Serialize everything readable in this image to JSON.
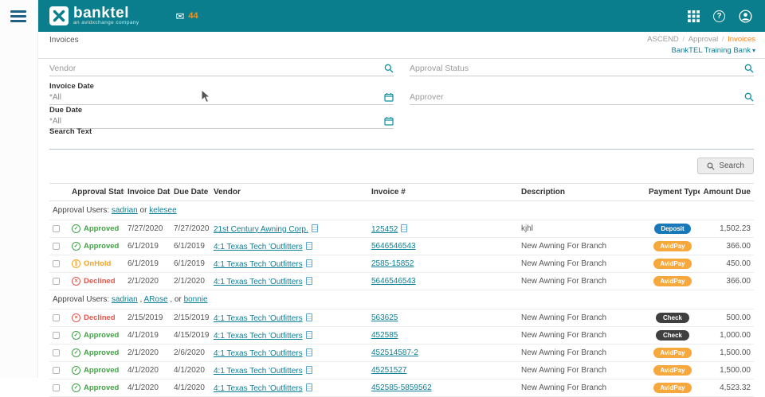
{
  "colors": {
    "header_teal": "#0a7e8c",
    "accent_orange": "#f58220",
    "link_teal": "#0e7f95",
    "status_approved": "#43a047",
    "status_onhold": "#f5a324",
    "status_declined": "#e2574c",
    "pill_deposit": "#1779ba",
    "pill_avidpay": "#f6a83c",
    "pill_check": "#3f3f3f"
  },
  "header": {
    "brand": "banktel",
    "brand_subtitle": "an avidxchange company",
    "inbox_count": "44"
  },
  "breadcrumb": {
    "page_title": "Invoices",
    "trail": [
      "ASCEND",
      "Approval",
      "Invoices"
    ],
    "separator": "/",
    "bank_name": "BankTEL Training Bank",
    "caret": "▾"
  },
  "filters": {
    "vendor": {
      "placeholder": "Vendor",
      "value": ""
    },
    "approval_status": {
      "placeholder": "Approval Status",
      "value": ""
    },
    "invoice_date": {
      "label": "Invoice Date",
      "value": "*All"
    },
    "approver": {
      "placeholder": "Approver",
      "value": ""
    },
    "due_date": {
      "label": "Due Date",
      "value": "*All"
    },
    "search_text": {
      "label": "Search Text",
      "value": ""
    },
    "search_button_label": "Search"
  },
  "status_icons": {
    "Approved": "✓",
    "OnHold": "∥",
    "Declined": "×"
  },
  "mail_glyph": "✉",
  "table": {
    "columns": [
      "",
      "Approval Status",
      "Invoice Date",
      "Due Date",
      "Vendor",
      "Invoice #",
      "Description",
      "Payment Type",
      "Amount Due"
    ],
    "groups": [
      {
        "prefix": "Approval Users: ",
        "parts": [
          {
            "text": "sadrian",
            "link": true
          },
          {
            "text": " or ",
            "link": false
          },
          {
            "text": "kelesee",
            "link": true
          }
        ],
        "rows": [
          {
            "status": "Approved",
            "invoice_date": "7/27/2020",
            "due_date": "7/27/2020",
            "vendor": "21st Century Awning Corp.",
            "invoice_no": "125452",
            "invoice_doc": true,
            "description": "kjhl",
            "payment_type": "Deposit",
            "amount_due": "1,502.23"
          },
          {
            "status": "Approved",
            "invoice_date": "6/1/2019",
            "due_date": "6/1/2019",
            "vendor": "4:1 Texas Tech 'Outfitters",
            "invoice_no": "5646546543",
            "invoice_doc": false,
            "description": "New Awning For Branch",
            "payment_type": "AvidPay",
            "amount_due": "366.00"
          },
          {
            "status": "OnHold",
            "invoice_date": "6/1/2019",
            "due_date": "6/1/2019",
            "vendor": "4:1 Texas Tech 'Outfitters",
            "invoice_no": "2585-15852",
            "invoice_doc": false,
            "description": "New Awning For Branch",
            "payment_type": "AvidPay",
            "amount_due": "450.00"
          },
          {
            "status": "Declined",
            "invoice_date": "2/1/2020",
            "due_date": "2/1/2020",
            "vendor": "4:1 Texas Tech 'Outfitters",
            "invoice_no": "5646546543",
            "invoice_doc": false,
            "description": "New Awning For Branch",
            "payment_type": "AvidPay",
            "amount_due": "366.00"
          }
        ]
      },
      {
        "prefix": "Approval Users: ",
        "parts": [
          {
            "text": "sadrian",
            "link": true
          },
          {
            "text": " , ",
            "link": false
          },
          {
            "text": "ARose",
            "link": true
          },
          {
            "text": " , or ",
            "link": false
          },
          {
            "text": "bonnie",
            "link": true
          }
        ],
        "rows": [
          {
            "status": "Declined",
            "invoice_date": "2/15/2019",
            "due_date": "2/15/2019",
            "vendor": "4:1 Texas Tech 'Outfitters",
            "invoice_no": "563625",
            "invoice_doc": false,
            "description": "New Awning For Branch",
            "payment_type": "Check",
            "amount_due": "500.00"
          },
          {
            "status": "Approved",
            "invoice_date": "4/1/2019",
            "due_date": "4/15/2019",
            "vendor": "4:1 Texas Tech 'Outfitters",
            "invoice_no": "452585",
            "invoice_doc": false,
            "description": "New Awning For Branch",
            "payment_type": "Check",
            "amount_due": "1,000.00"
          },
          {
            "status": "Approved",
            "invoice_date": "2/1/2020",
            "due_date": "2/6/2020",
            "vendor": "4:1 Texas Tech 'Outfitters",
            "invoice_no": "452514587-2",
            "invoice_doc": false,
            "description": "New Awning For Branch",
            "payment_type": "AvidPay",
            "amount_due": "1,500.00"
          },
          {
            "status": "Approved",
            "invoice_date": "4/1/2020",
            "due_date": "4/1/2020",
            "vendor": "4:1 Texas Tech 'Outfitters",
            "invoice_no": "45251527",
            "invoice_doc": false,
            "description": "New Awning For Branch",
            "payment_type": "AvidPay",
            "amount_due": "1,500.00"
          },
          {
            "status": "Approved",
            "invoice_date": "4/1/2020",
            "due_date": "4/1/2020",
            "vendor": "4:1 Texas Tech 'Outfitters",
            "invoice_no": "452585-5859562",
            "invoice_doc": false,
            "description": "New Awning For Branch",
            "payment_type": "AvidPay",
            "amount_due": "4,523.32"
          }
        ]
      }
    ]
  }
}
